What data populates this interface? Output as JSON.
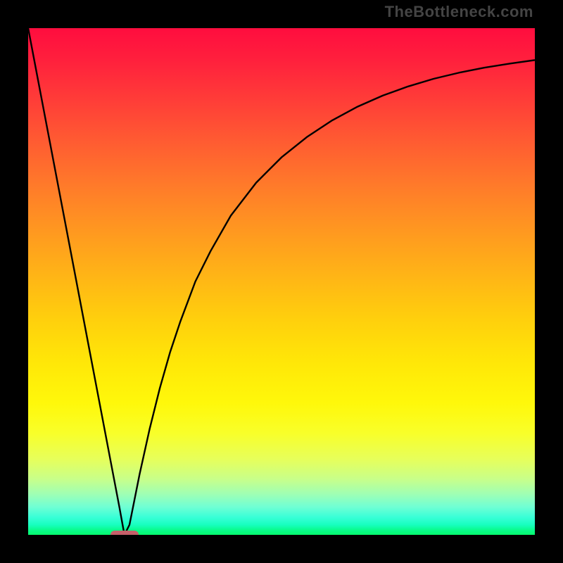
{
  "watermark": "TheBottleneck.com",
  "colors": {
    "frame": "#000000",
    "curve": "#000000",
    "marker": "#c6606a"
  },
  "chart_data": {
    "type": "line",
    "title": "",
    "xlabel": "",
    "ylabel": "",
    "xlim": [
      0,
      100
    ],
    "ylim": [
      0,
      100
    ],
    "x": [
      0,
      2,
      4,
      6,
      8,
      10,
      12,
      14,
      16,
      18,
      19,
      20,
      21,
      22,
      24,
      26,
      28,
      30,
      33,
      36,
      40,
      45,
      50,
      55,
      60,
      65,
      70,
      75,
      80,
      85,
      90,
      95,
      100
    ],
    "y": [
      100,
      89.5,
      79,
      68.5,
      58,
      47.5,
      37,
      26.5,
      16,
      5.5,
      0,
      2,
      7,
      12,
      21,
      29,
      36,
      42,
      50,
      56,
      63,
      69.5,
      74.5,
      78.5,
      81.8,
      84.5,
      86.7,
      88.5,
      90,
      91.2,
      92.2,
      93,
      93.7
    ],
    "marker_x": 19,
    "marker_y": 0,
    "gradient_stops": [
      {
        "pos": 0,
        "color": "#ff0d3e"
      },
      {
        "pos": 0.5,
        "color": "#ffd10c"
      },
      {
        "pos": 0.8,
        "color": "#f8ff2a"
      },
      {
        "pos": 1.0,
        "color": "#06f96e"
      }
    ]
  }
}
